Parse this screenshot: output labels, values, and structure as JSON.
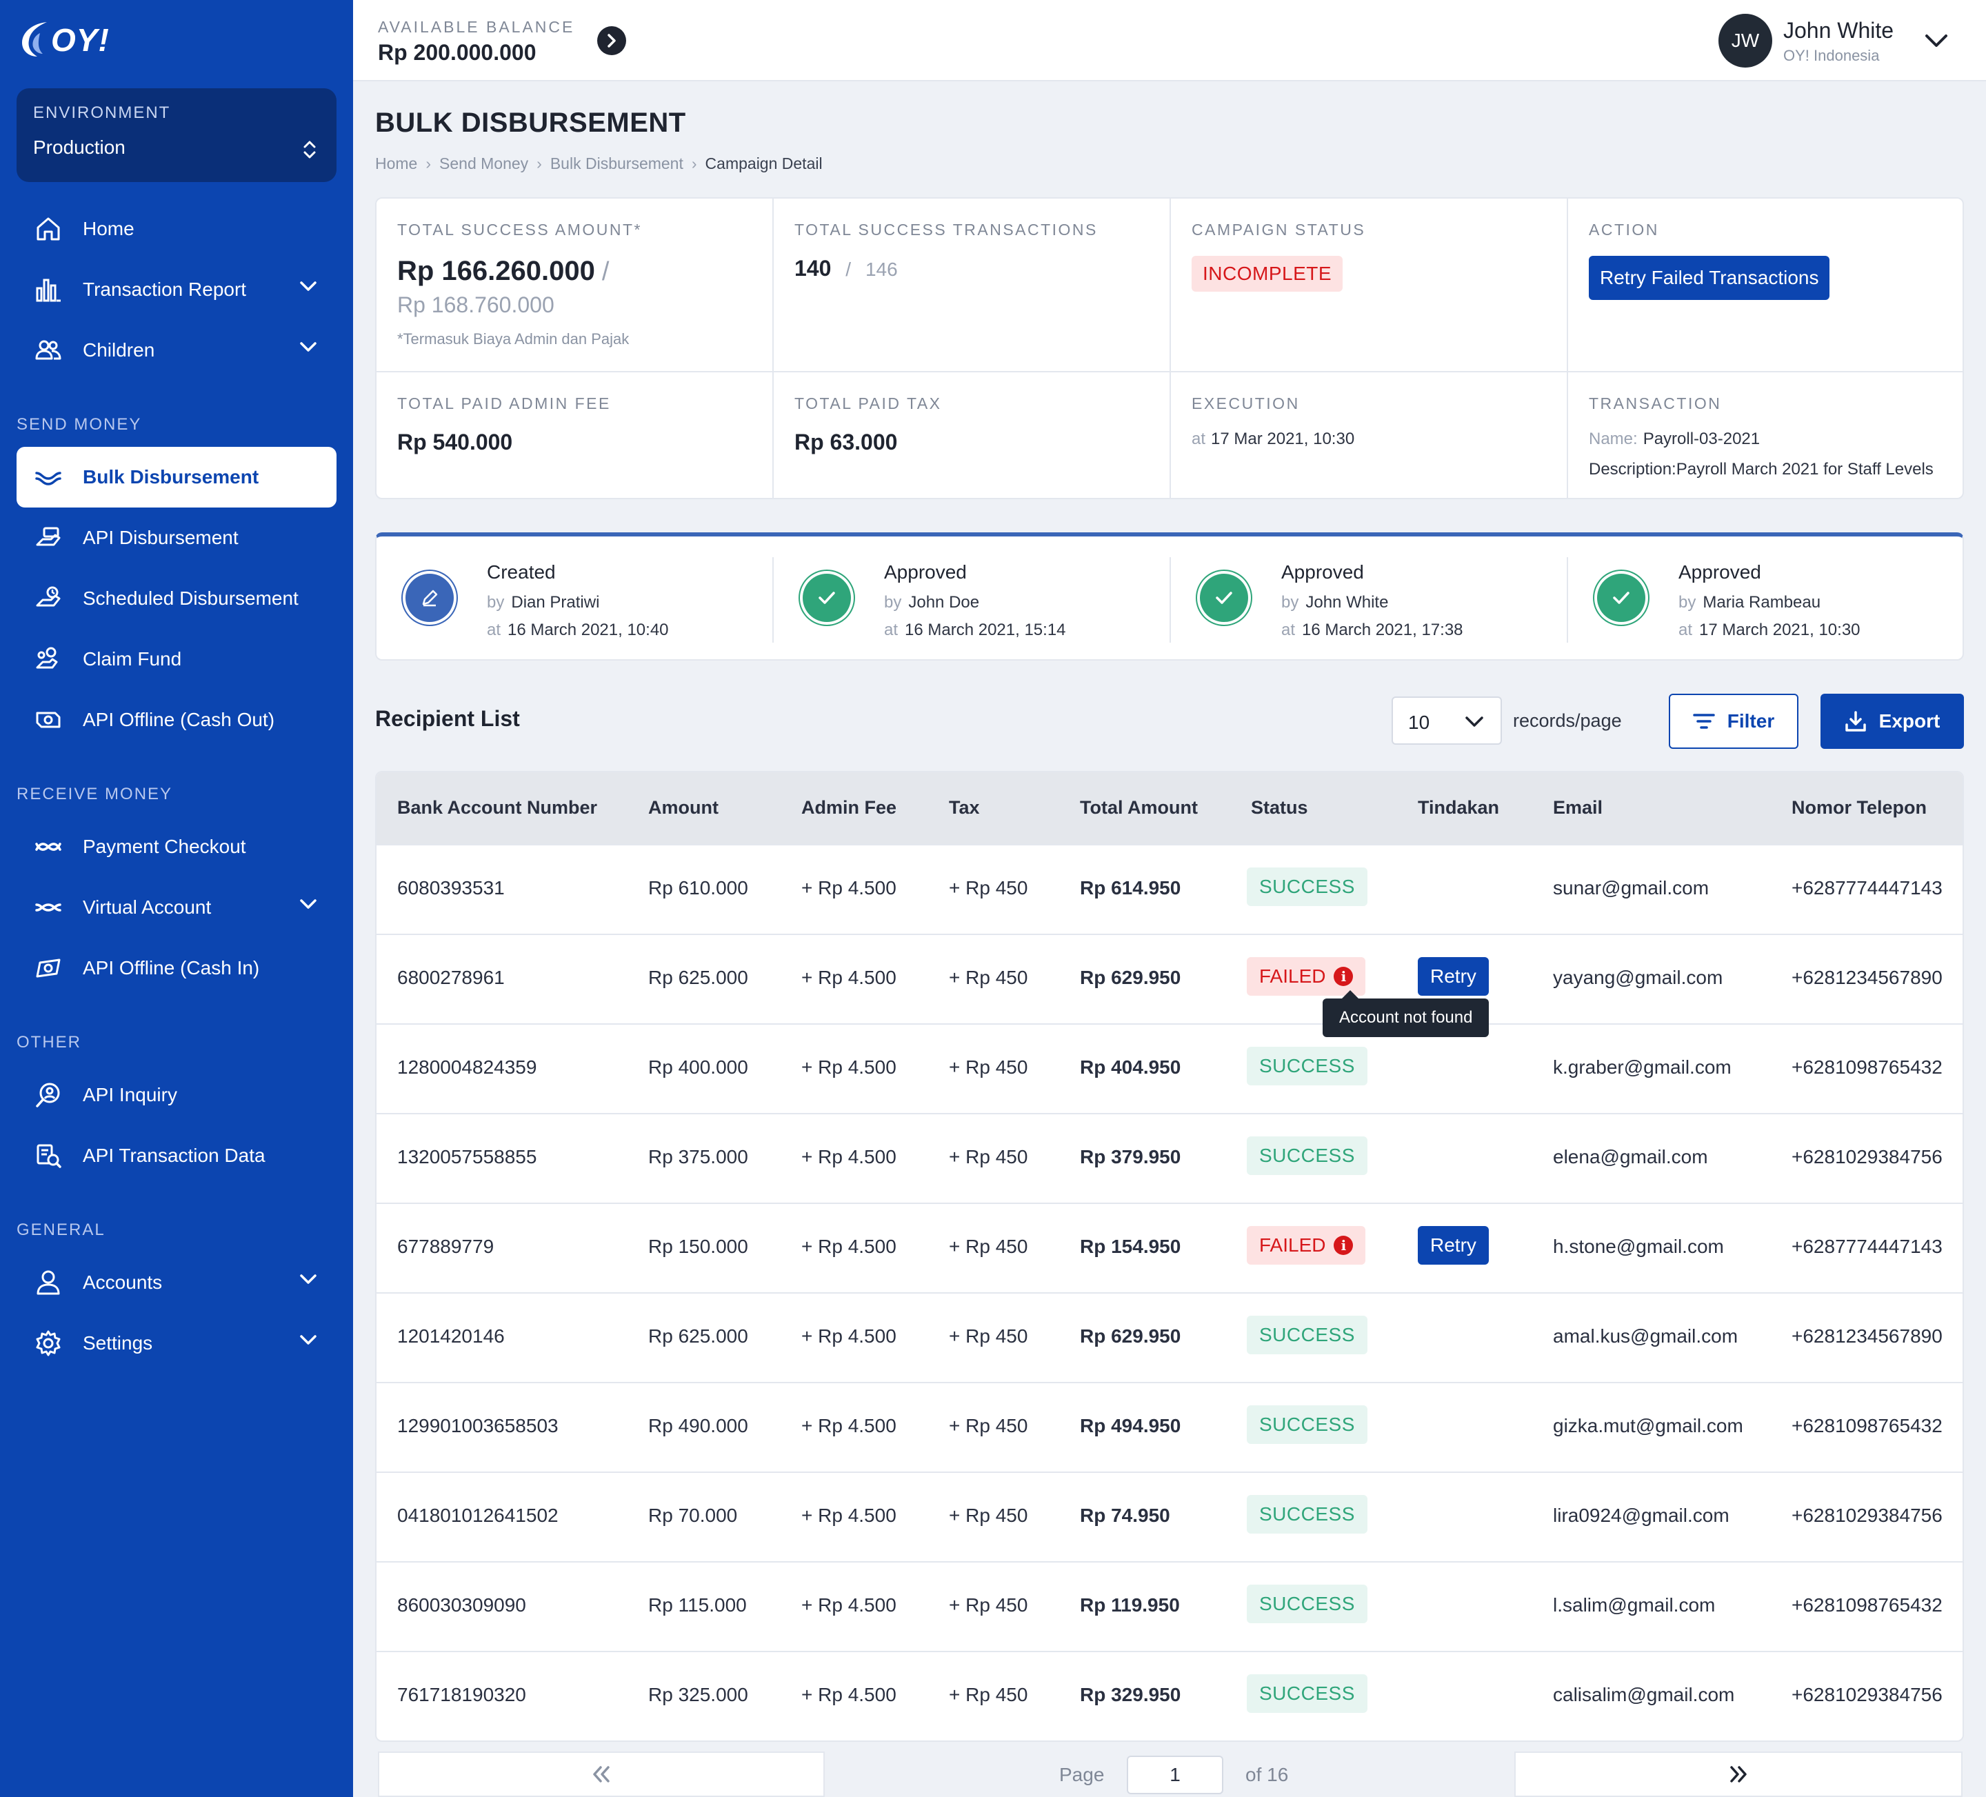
{
  "sidebar": {
    "logo": "OY!",
    "environment": {
      "label": "ENVIRONMENT",
      "value": "Production"
    },
    "items": [
      {
        "label": "Home",
        "icon": "home-icon"
      },
      {
        "label": "Transaction Report",
        "icon": "bar-chart-icon"
      },
      {
        "label": "Children",
        "icon": "users-icon"
      },
      {
        "label": "Bulk Disbursement",
        "icon": "bulk-disbursement-icon"
      },
      {
        "label": "API Disbursement",
        "icon": "api-disbursement-icon"
      },
      {
        "label": "Scheduled Disbursement",
        "icon": "scheduled-disbursement-icon"
      },
      {
        "label": "Claim Fund",
        "icon": "claim-fund-icon"
      },
      {
        "label": "API Offline (Cash Out)",
        "icon": "cash-out-icon"
      },
      {
        "label": "Payment Checkout",
        "icon": "payment-checkout-icon"
      },
      {
        "label": "Virtual Account",
        "icon": "virtual-account-icon"
      },
      {
        "label": "API Offline (Cash In)",
        "icon": "cash-in-icon"
      },
      {
        "label": "API Inquiry",
        "icon": "inquiry-icon"
      },
      {
        "label": "API Transaction Data",
        "icon": "transaction-data-icon"
      },
      {
        "label": "Accounts",
        "icon": "user-icon"
      },
      {
        "label": "Settings",
        "icon": "gear-icon"
      }
    ],
    "sections": [
      "SEND MONEY",
      "RECEIVE MONEY",
      "OTHER",
      "GENERAL"
    ]
  },
  "topbar": {
    "balance_label": "AVAILABLE BALANCE",
    "balance_value": "Rp 200.000.000",
    "user_initials": "JW",
    "user_name": "John White",
    "user_org": "OY! Indonesia"
  },
  "page": {
    "title": "BULK DISBURSEMENT",
    "breadcrumb": [
      "Home",
      "Send Money",
      "Bulk Disbursement",
      "Campaign Detail"
    ]
  },
  "summary": {
    "success_amount_label": "TOTAL SUCCESS AMOUNT*",
    "success_amount": "Rp 166.260.000",
    "success_amount_slash": "/",
    "total_amount": "Rp 168.760.000",
    "amount_note": "*Termasuk Biaya Admin dan Pajak",
    "success_tx_label": "TOTAL SUCCESS TRANSACTIONS",
    "success_tx": "140",
    "tx_slash": "/",
    "total_tx": "146",
    "status_label": "CAMPAIGN STATUS",
    "status": "INCOMPLETE",
    "action_label": "ACTION",
    "action_button": "Retry Failed Transactions",
    "admin_fee_label": "TOTAL PAID ADMIN FEE",
    "admin_fee": "Rp 540.000",
    "tax_label": "TOTAL PAID TAX",
    "tax": "Rp 63.000",
    "execution_label": "EXECUTION",
    "execution_at_key": "at",
    "execution_at": "17 Mar 2021, 10:30",
    "transaction_label": "TRANSACTION",
    "name_key": "Name:",
    "name_value": "Payroll-03-2021",
    "desc_key": "Description:",
    "desc_value": "Payroll March 2021 for Staff Levels"
  },
  "timeline": [
    {
      "title": "Created",
      "by_key": "by",
      "by": "Dian Pratiwi",
      "at_key": "at",
      "at": "16 March 2021, 10:40",
      "icon": "edit-icon"
    },
    {
      "title": "Approved",
      "by_key": "by",
      "by": "John Doe",
      "at_key": "at",
      "at": "16 March 2021, 15:14",
      "icon": "check-circle-icon"
    },
    {
      "title": "Approved",
      "by_key": "by",
      "by": "John White",
      "at_key": "at",
      "at": "16 March 2021, 17:38",
      "icon": "check-circle-icon"
    },
    {
      "title": "Approved",
      "by_key": "by",
      "by": "Maria Rambeau",
      "at_key": "at",
      "at": "17 March 2021, 10:30",
      "icon": "check-circle-icon"
    }
  ],
  "recipients": {
    "title": "Recipient List",
    "records_per_page": "10",
    "records_label": "records/page",
    "filter_label": "Filter",
    "export_label": "Export",
    "columns": [
      "Bank Account Number",
      "Amount",
      "Admin Fee",
      "Tax",
      "Total Amount",
      "Status",
      "Tindakan",
      "Email",
      "Nomor Telepon"
    ],
    "rows": [
      {
        "account": "6080393531",
        "amount": "Rp 610.000",
        "fee": "+ Rp 4.500",
        "tax": "+ Rp 450",
        "total": "Rp 614.950",
        "status": "SUCCESS",
        "action": "",
        "email": "sunar@gmail.com",
        "phone": "+6287774447143"
      },
      {
        "account": "6800278961",
        "amount": "Rp 625.000",
        "fee": "+ Rp 4.500",
        "tax": "+ Rp 450",
        "total": "Rp 629.950",
        "status": "FAILED",
        "action": "Retry",
        "email": "yayang@gmail.com",
        "phone": "+6281234567890"
      },
      {
        "account": "1280004824359",
        "amount": "Rp 400.000",
        "fee": "+ Rp 4.500",
        "tax": "+ Rp 450",
        "total": "Rp 404.950",
        "status": "SUCCESS",
        "action": "",
        "email": "k.graber@gmail.com",
        "phone": "+6281098765432"
      },
      {
        "account": "1320057558855",
        "amount": "Rp 375.000",
        "fee": "+ Rp 4.500",
        "tax": "+ Rp 450",
        "total": "Rp 379.950",
        "status": "SUCCESS",
        "action": "",
        "email": "elena@gmail.com",
        "phone": "+6281029384756"
      },
      {
        "account": "677889779",
        "amount": "Rp 150.000",
        "fee": "+ Rp 4.500",
        "tax": "+ Rp 450",
        "total": "Rp 154.950",
        "status": "FAILED",
        "action": "Retry",
        "email": "h.stone@gmail.com",
        "phone": "+6287774447143"
      },
      {
        "account": "1201420146",
        "amount": "Rp 625.000",
        "fee": "+ Rp 4.500",
        "tax": "+ Rp 450",
        "total": "Rp 629.950",
        "status": "SUCCESS",
        "action": "",
        "email": "amal.kus@gmail.com",
        "phone": "+6281234567890"
      },
      {
        "account": "129901003658503",
        "amount": "Rp 490.000",
        "fee": "+ Rp 4.500",
        "tax": "+ Rp 450",
        "total": "Rp 494.950",
        "status": "SUCCESS",
        "action": "",
        "email": "gizka.mut@gmail.com",
        "phone": "+6281098765432"
      },
      {
        "account": "041801012641502",
        "amount": "Rp 70.000",
        "fee": "+ Rp 4.500",
        "tax": "+ Rp 450",
        "total": "Rp 74.950",
        "status": "SUCCESS",
        "action": "",
        "email": "lira0924@gmail.com",
        "phone": "+6281029384756"
      },
      {
        "account": "860030309090",
        "amount": "Rp 115.000",
        "fee": "+ Rp 4.500",
        "tax": "+ Rp 450",
        "total": "Rp 119.950",
        "status": "SUCCESS",
        "action": "",
        "email": "l.salim@gmail.com",
        "phone": "+6281098765432"
      },
      {
        "account": "761718190320",
        "amount": "Rp 325.000",
        "fee": "+ Rp 4.500",
        "tax": "+ Rp 450",
        "total": "Rp 329.950",
        "status": "SUCCESS",
        "action": "",
        "email": "calisalim@gmail.com",
        "phone": "+6281029384756"
      }
    ],
    "tooltip": "Account not found"
  },
  "pagination": {
    "page_label": "Page",
    "current_page": "1",
    "of_label": "of 16"
  },
  "colors": {
    "brand": "#0c45b0",
    "sidebar_dark": "#0a2f78",
    "success": "#2fa57a",
    "failed": "#d6171a",
    "approved": "#2fa57a"
  }
}
